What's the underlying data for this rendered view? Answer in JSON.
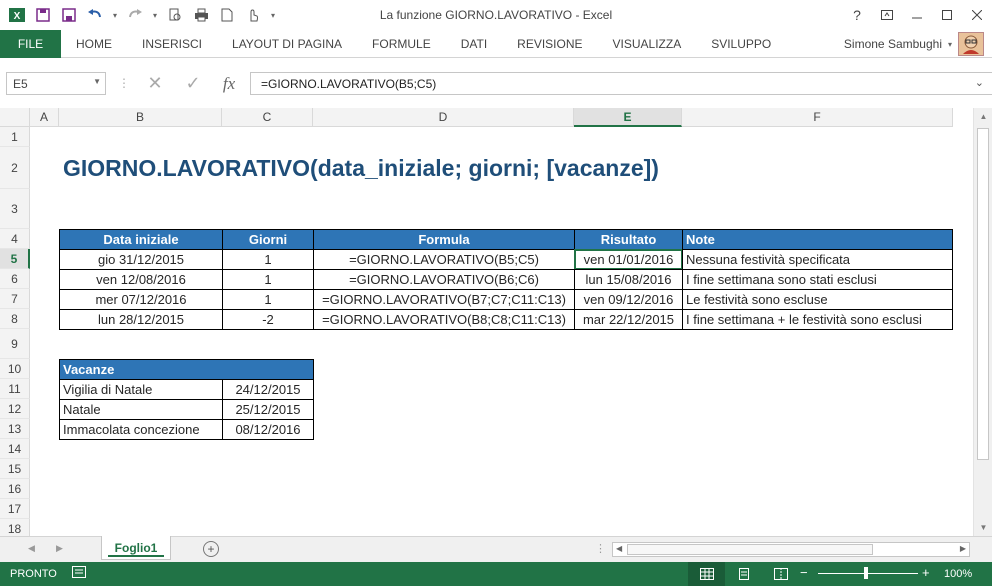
{
  "window": {
    "title": "La funzione GIORNO.LAVORATIVO - Excel",
    "help": "?"
  },
  "ribbon": {
    "file": "FILE",
    "tabs": [
      "HOME",
      "INSERISCI",
      "LAYOUT DI PAGINA",
      "FORMULE",
      "DATI",
      "REVISIONE",
      "VISUALIZZA",
      "SVILUPPO"
    ],
    "user": "Simone Sambughi"
  },
  "formula_bar": {
    "name_box": "E5",
    "fx": "fx",
    "formula": "=GIORNO.LAVORATIVO(B5;C5)"
  },
  "columns": [
    "A",
    "B",
    "C",
    "D",
    "E",
    "F"
  ],
  "rows": [
    "1",
    "2",
    "3",
    "4",
    "5",
    "6",
    "7",
    "8",
    "9",
    "10",
    "11",
    "12",
    "13",
    "14",
    "15",
    "16",
    "17",
    "18"
  ],
  "sheet": {
    "title": "GIORNO.LAVORATIVO(data_iniziale; giorni; [vacanze])",
    "table_headers": [
      "Data iniziale",
      "Giorni",
      "Formula",
      "Risultato",
      "Note"
    ],
    "table_rows": [
      [
        "gio 31/12/2015",
        "1",
        "=GIORNO.LAVORATIVO(B5;C5)",
        "ven 01/01/2016",
        "Nessuna festività specificata"
      ],
      [
        "ven 12/08/2016",
        "1",
        "=GIORNO.LAVORATIVO(B6;C6)",
        "lun 15/08/2016",
        "I fine settimana sono stati esclusi"
      ],
      [
        "mer 07/12/2016",
        "1",
        "=GIORNO.LAVORATIVO(B7;C7;C11:C13)",
        "ven 09/12/2016",
        "Le festività sono escluse"
      ],
      [
        "lun 28/12/2015",
        "-2",
        "=GIORNO.LAVORATIVO(B8;C8;C11:C13)",
        "mar 22/12/2015",
        "I fine settimana + le festività sono esclusi"
      ]
    ],
    "holidays_header": "Vacanze",
    "holidays": [
      [
        "Vigilia di Natale",
        "24/12/2015"
      ],
      [
        "Natale",
        "25/12/2015"
      ],
      [
        "Immacolata concezione",
        "08/12/2016"
      ]
    ]
  },
  "sheet_tabs": {
    "active": "Foglio1",
    "add": "+"
  },
  "status": {
    "ready": "PRONTO",
    "zoom": "100%"
  },
  "colors": {
    "excel_green": "#217346",
    "header_blue": "#2e75b6",
    "title_blue": "#1f4e79"
  }
}
